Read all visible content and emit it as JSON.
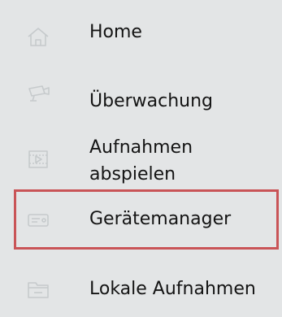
{
  "menu": {
    "items": [
      {
        "label": "Home",
        "icon": "home-icon"
      },
      {
        "label": "Überwachung",
        "icon": "camera-icon"
      },
      {
        "label": "Aufnahmen abspielen",
        "line1": "Aufnahmen",
        "line2": "abspielen",
        "icon": "playback-icon"
      },
      {
        "label": "Gerätemanager",
        "icon": "device-icon",
        "highlighted": true
      },
      {
        "label": "Lokale Aufnahmen",
        "icon": "folder-icon"
      }
    ],
    "highlight_color": "#c95457",
    "icon_color": "#c6cacc"
  }
}
